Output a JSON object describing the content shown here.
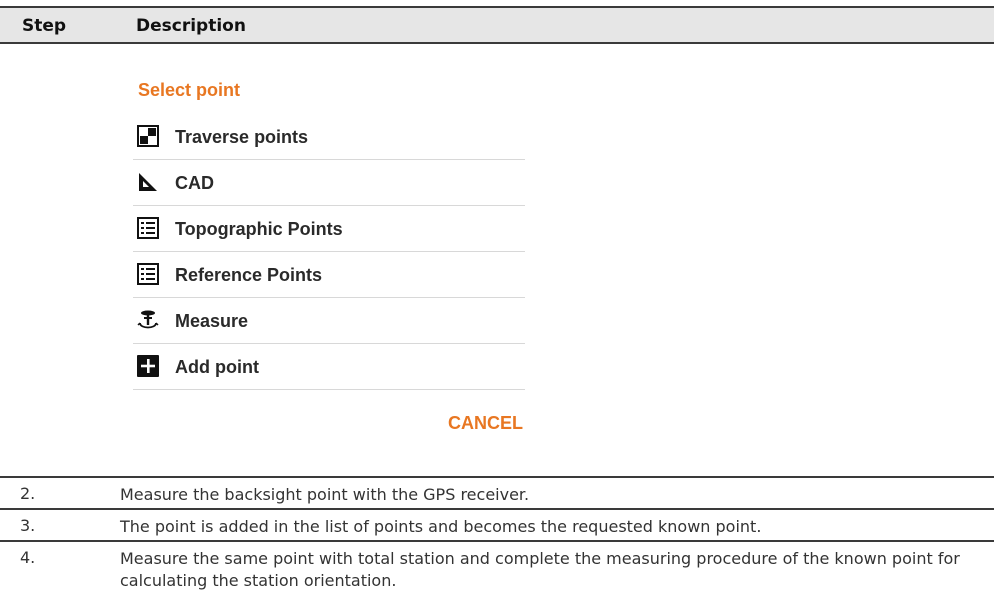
{
  "table": {
    "header": {
      "step": "Step",
      "description": "Description"
    },
    "rows": [
      {
        "step": "2.",
        "description": "Measure the backsight point with the GPS receiver."
      },
      {
        "step": "3.",
        "description": "The point is added in the list of points and becomes the requested known point."
      },
      {
        "step": "4.",
        "description": "Measure the same point with total station and complete the measuring procedure of the known point for calculating the station orientation."
      }
    ]
  },
  "dialog": {
    "title": "Select point",
    "items": [
      {
        "label": "Traverse points",
        "icon": "traverse-points-icon"
      },
      {
        "label": "CAD",
        "icon": "cad-triangle-icon"
      },
      {
        "label": "Topographic Points",
        "icon": "list-icon"
      },
      {
        "label": "Reference Points",
        "icon": "list-icon"
      },
      {
        "label": "Measure",
        "icon": "gps-receiver-icon"
      },
      {
        "label": "Add point",
        "icon": "add-icon"
      }
    ],
    "cancel_label": "CANCEL"
  },
  "colors": {
    "accent": "#e87722",
    "header_bg": "#e6e6e6",
    "rule": "#3a3a3a"
  }
}
